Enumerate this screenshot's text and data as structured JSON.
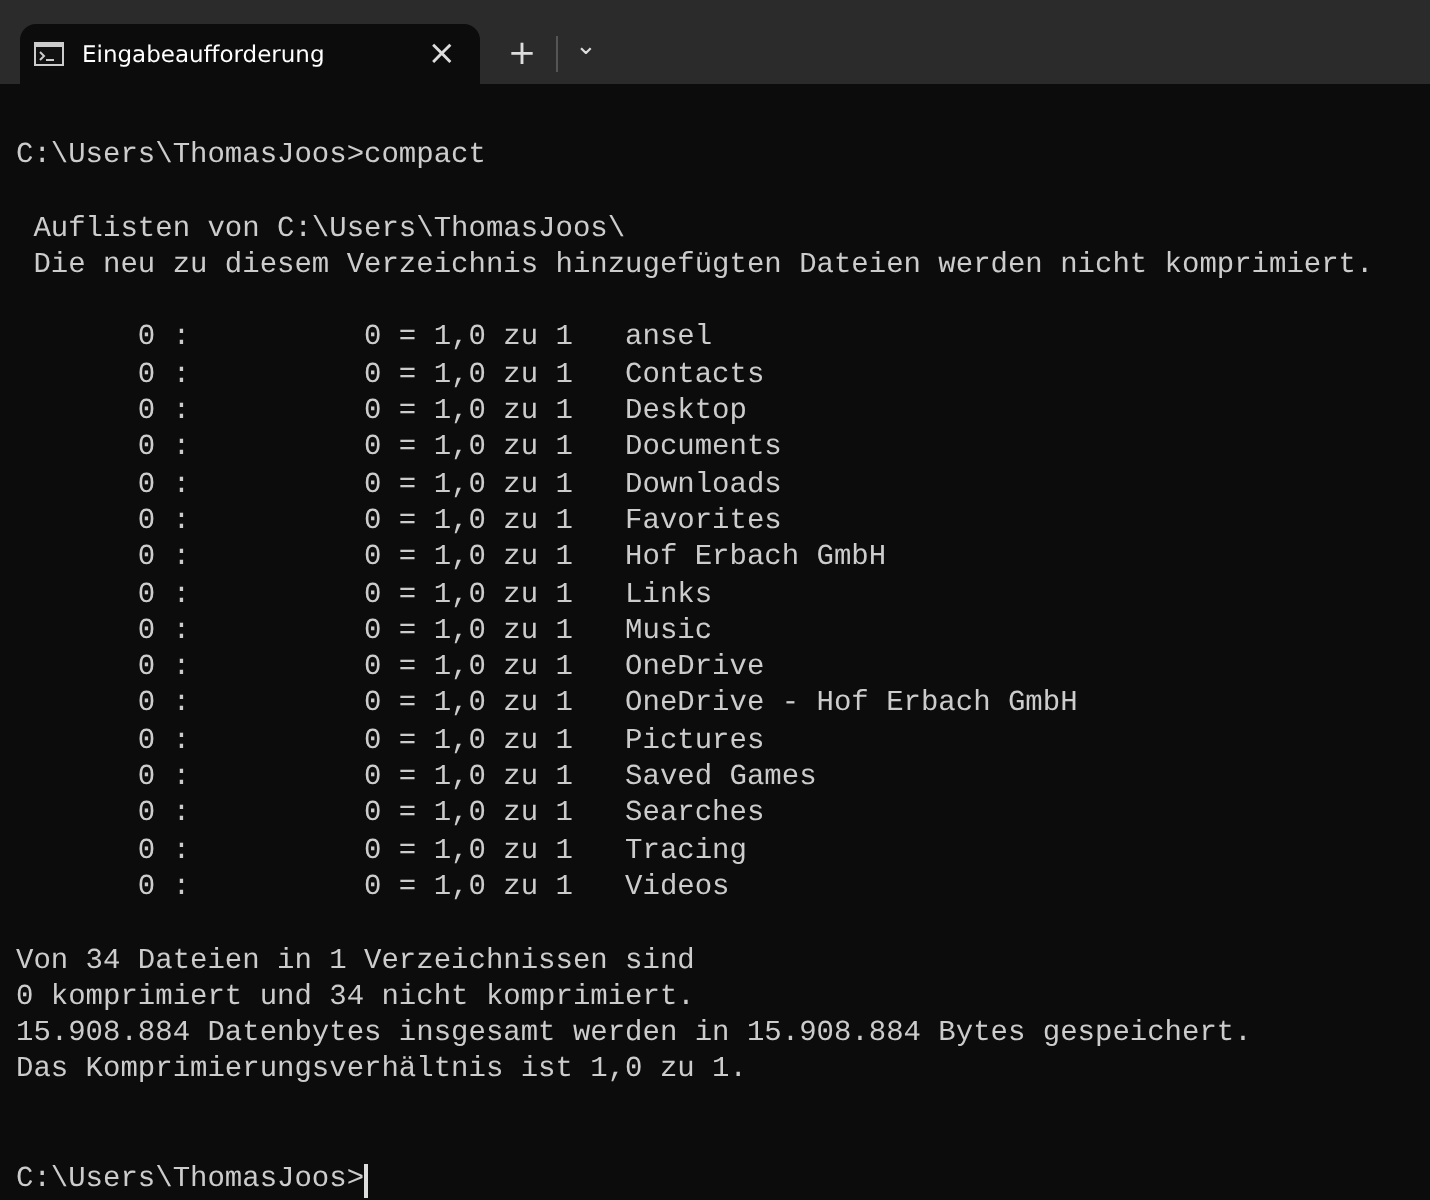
{
  "tabs": [
    {
      "title": "Eingabeaufforderung",
      "selected": true,
      "close": "×"
    }
  ],
  "tab_bar": {
    "new_tab": "+",
    "dropdown": "⌄"
  },
  "terminal": {
    "command_line": "C:\\Users\\ThomasJoos>compact",
    "header": [
      " Auflisten von C:\\Users\\ThomasJoos\\",
      " Die neu zu diesem Verzeichnis hinzugefügten Dateien werden nicht komprimiert."
    ],
    "rows": [
      {
        "size": "0 :",
        "ratio": "0 = 1,0 zu 1",
        "name": "ansel"
      },
      {
        "size": "0 :",
        "ratio": "0 = 1,0 zu 1",
        "name": "Contacts"
      },
      {
        "size": "0 :",
        "ratio": "0 = 1,0 zu 1",
        "name": "Desktop"
      },
      {
        "size": "0 :",
        "ratio": "0 = 1,0 zu 1",
        "name": "Documents"
      },
      {
        "size": "0 :",
        "ratio": "0 = 1,0 zu 1",
        "name": "Downloads"
      },
      {
        "size": "0 :",
        "ratio": "0 = 1,0 zu 1",
        "name": "Favorites"
      },
      {
        "size": "0 :",
        "ratio": "0 = 1,0 zu 1",
        "name": "Hof Erbach GmbH"
      },
      {
        "size": "0 :",
        "ratio": "0 = 1,0 zu 1",
        "name": "Links"
      },
      {
        "size": "0 :",
        "ratio": "0 = 1,0 zu 1",
        "name": "Music"
      },
      {
        "size": "0 :",
        "ratio": "0 = 1,0 zu 1",
        "name": "OneDrive"
      },
      {
        "size": "0 :",
        "ratio": "0 = 1,0 zu 1",
        "name": "OneDrive - Hof Erbach GmbH"
      },
      {
        "size": "0 :",
        "ratio": "0 = 1,0 zu 1",
        "name": "Pictures"
      },
      {
        "size": "0 :",
        "ratio": "0 = 1,0 zu 1",
        "name": "Saved Games"
      },
      {
        "size": "0 :",
        "ratio": "0 = 1,0 zu 1",
        "name": "Searches"
      },
      {
        "size": "0 :",
        "ratio": "0 = 1,0 zu 1",
        "name": "Tracing"
      },
      {
        "size": "0 :",
        "ratio": "0 = 1,0 zu 1",
        "name": "Videos"
      }
    ],
    "summary": [
      "Von 34 Dateien in 1 Verzeichnissen sind",
      "0 komprimiert und 34 nicht komprimiert.",
      "15.908.884 Datenbytes insgesamt werden in 15.908.884 Bytes gespeichert.",
      "Das Komprimierungsverhältnis ist 1,0 zu 1."
    ],
    "prompt": "C:\\Users\\ThomasJoos>"
  }
}
